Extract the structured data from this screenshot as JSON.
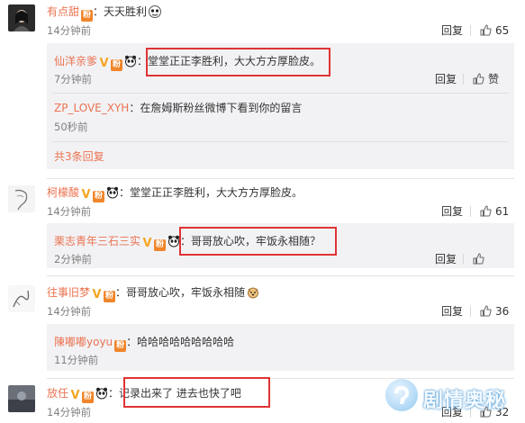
{
  "c1": {
    "name": "有点甜",
    "sep": "：",
    "text": "天天胜利",
    "time": "14分钟前",
    "reply": "回复",
    "likes": "65",
    "replies": [
      {
        "name": "仙洋亲爹",
        "sep": "：",
        "text": "堂堂正正李胜利，大大方方厚脸皮。",
        "time": "7分钟前",
        "reply": "回复",
        "like_label": "赞"
      },
      {
        "name": "ZP_LOVE_XYH",
        "sep": "：",
        "text": "在詹姆斯粉丝微博下看到你的留言",
        "time": "50秒前"
      }
    ],
    "more": "共3条回复"
  },
  "c2": {
    "name": "柯檬酸",
    "sep": "：",
    "text": "堂堂正正李胜利，大大方方厚脸皮。",
    "time": "14分钟前",
    "reply": "回复",
    "likes": "61",
    "reply1": {
      "name": "栗志青年三石三实",
      "sep": "：",
      "text": "哥哥放心吹，牢饭永相随？",
      "time": "2分钟前",
      "reply": "回复"
    }
  },
  "c3": {
    "name": "往事旧梦",
    "sep": "：",
    "text": "哥哥放心吹，牢饭永相随",
    "time": "14分钟前",
    "reply": "回复",
    "likes": "36",
    "reply1": {
      "name": "陳嘟嘟yoyu",
      "sep": "：",
      "text": "哈哈哈哈哈哈哈哈哈",
      "time": "11分钟前"
    }
  },
  "c4": {
    "name": "放任",
    "sep": "：",
    "text": "记录出来了  进去也快了吧",
    "time": "14分钟前",
    "reply": "回复",
    "likes": "32"
  },
  "badges": {
    "v": "V",
    "fan": "粉"
  },
  "watermark": {
    "text": "剧情奥秘"
  },
  "colors": {
    "name": "#eb7350",
    "highlight": "#e03333",
    "reply_bg": "#f2f2f5",
    "v_badge": "#f5a623"
  }
}
